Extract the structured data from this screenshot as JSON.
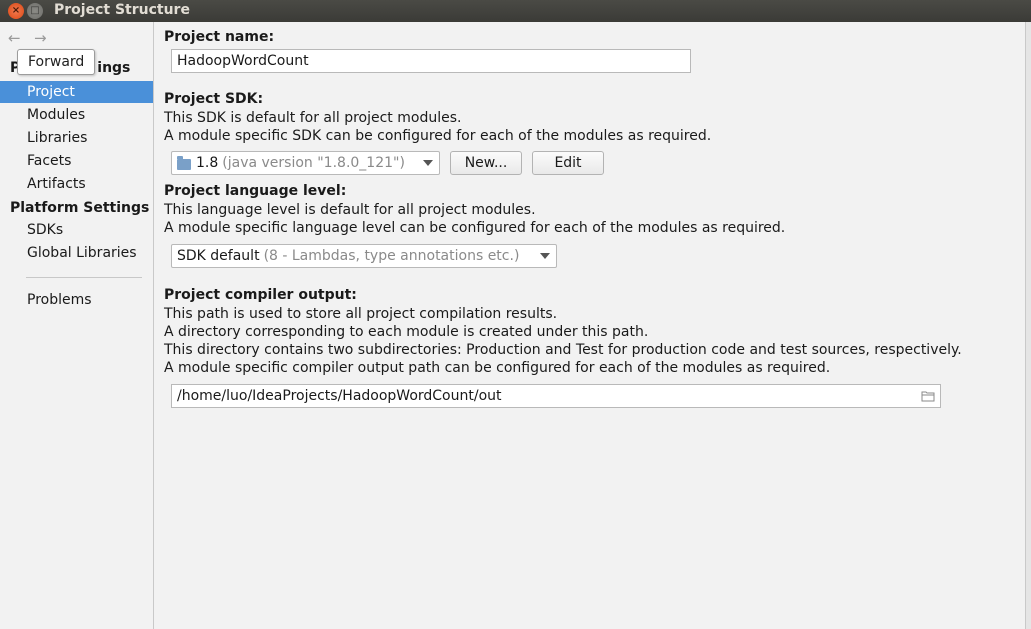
{
  "window": {
    "title": "Project Structure",
    "close_glyph": "×",
    "max_glyph": "□"
  },
  "nav": {
    "back_icon": "←",
    "forward_icon": "→",
    "tooltip": "Forward"
  },
  "sidebar": {
    "project_settings_title": "Project Settings",
    "project_settings_visible_fragment": "ings",
    "project_settings_prefix": "P",
    "items": [
      {
        "label": "Project",
        "selected": true
      },
      {
        "label": "Modules"
      },
      {
        "label": "Libraries"
      },
      {
        "label": "Facets"
      },
      {
        "label": "Artifacts"
      }
    ],
    "platform_settings_title": "Platform Settings",
    "platform_items": [
      {
        "label": "SDKs"
      },
      {
        "label": "Global Libraries"
      }
    ],
    "problems_label": "Problems"
  },
  "project_name": {
    "label": "Project name:",
    "value": "HadoopWordCount"
  },
  "project_sdk": {
    "label": "Project SDK:",
    "desc_line1": "This SDK is default for all project modules.",
    "desc_line2": "A module specific SDK can be configured for each of the modules as required.",
    "selected_version": "1.8",
    "selected_detail": "(java version \"1.8.0_121\")",
    "new_button": "New...",
    "edit_button": "Edit"
  },
  "language_level": {
    "label": "Project language level:",
    "desc_line1": "This language level is default for all project modules.",
    "desc_line2": "A module specific language level can be configured for each of the modules as required.",
    "selected": "SDK default",
    "selected_detail": "(8 - Lambdas, type annotations etc.)"
  },
  "compiler_output": {
    "label": "Project compiler output:",
    "desc_line1": "This path is used to store all project compilation results.",
    "desc_line2": "A directory corresponding to each module is created under this path.",
    "desc_line3": "This directory contains two subdirectories: Production and Test for production code and test sources, respectively.",
    "desc_line4": "A module specific compiler output path can be configured for each of the modules as required.",
    "path": "/home/luo/IdeaProjects/HadoopWordCount/out"
  },
  "colors": {
    "selection": "#4a90d9",
    "titlebar": "#3c3b37",
    "close_button": "#dd4814"
  }
}
